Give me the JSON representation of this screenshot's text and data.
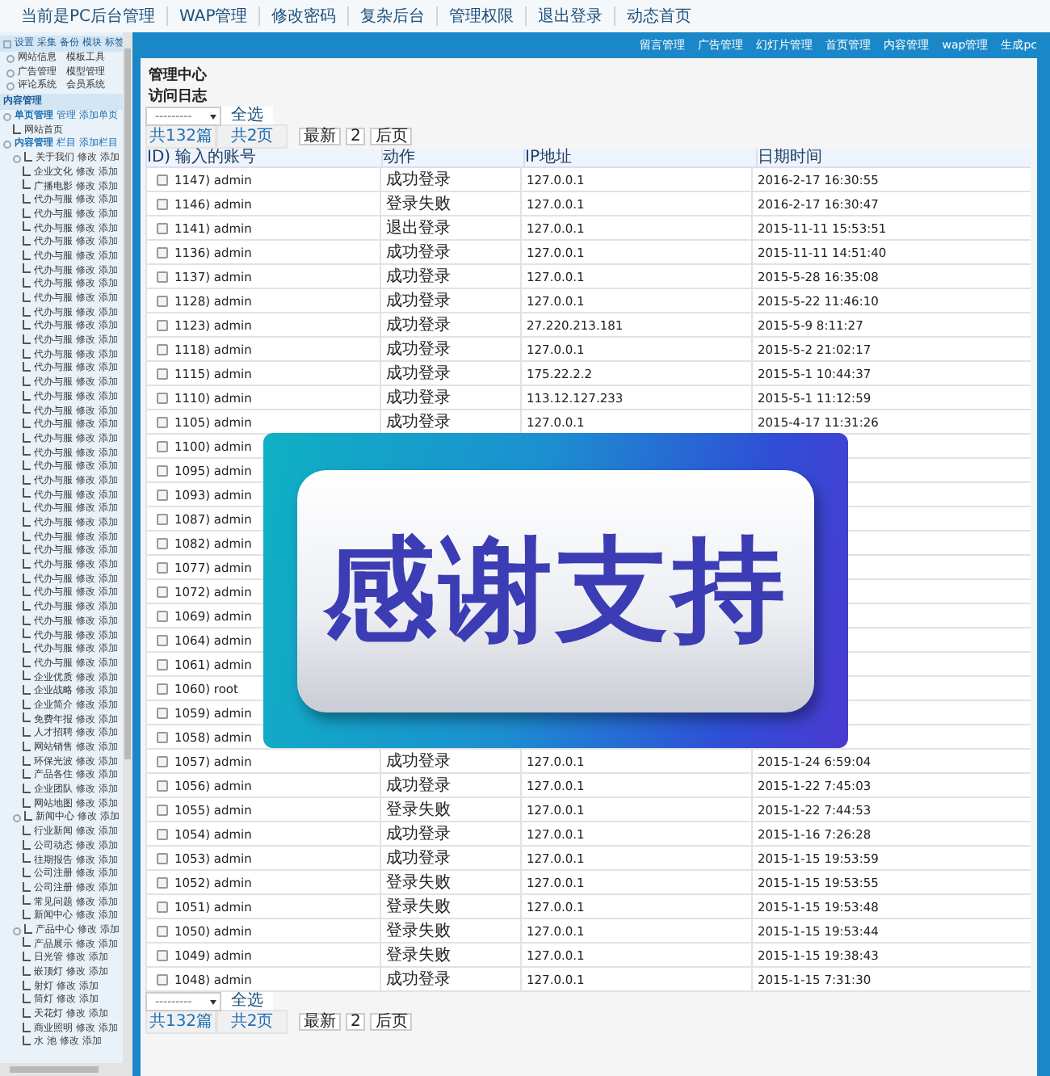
{
  "top_nav": [
    "当前是PC后台管理",
    "WAP管理",
    "修改密码",
    "复杂后台",
    "管理权限",
    "退出登录",
    "动态首页"
  ],
  "sidebar": {
    "top_links": [
      "设置",
      "采集",
      "备份",
      "模块",
      "标签"
    ],
    "tools": [
      [
        "网站信息",
        "模板工具"
      ],
      [
        "广告管理",
        "模型管理"
      ],
      [
        "评论系统",
        "会员系统"
      ]
    ],
    "section_title": "内容管理",
    "groups": [
      {
        "name": "单页管理",
        "actions": [
          "管理",
          "添加单页"
        ],
        "children": [
          {
            "name": "网站首页"
          }
        ]
      },
      {
        "name": "内容管理",
        "actions": [
          "栏目",
          "添加栏目"
        ],
        "children": [
          {
            "name": "关于我们",
            "actions": [
              "修改",
              "添加"
            ],
            "children": [
              {
                "name": "企业文化",
                "actions": [
                  "修改",
                  "添加"
                ]
              },
              {
                "name": "广播电影",
                "actions": [
                  "修改",
                  "添加"
                ]
              },
              {
                "name": "代办与服",
                "actions": [
                  "修改",
                  "添加"
                ]
              },
              {
                "name": "代办与服",
                "actions": [
                  "修改",
                  "添加"
                ]
              },
              {
                "name": "代办与服",
                "actions": [
                  "修改",
                  "添加"
                ]
              },
              {
                "name": "代办与服",
                "actions": [
                  "修改",
                  "添加"
                ]
              },
              {
                "name": "代办与服",
                "actions": [
                  "修改",
                  "添加"
                ]
              },
              {
                "name": "代办与服",
                "actions": [
                  "修改",
                  "添加"
                ]
              },
              {
                "name": "代办与服",
                "actions": [
                  "修改",
                  "添加"
                ]
              },
              {
                "name": "代办与服",
                "actions": [
                  "修改",
                  "添加"
                ]
              },
              {
                "name": "代办与服",
                "actions": [
                  "修改",
                  "添加"
                ]
              },
              {
                "name": "代办与服",
                "actions": [
                  "修改",
                  "添加"
                ]
              },
              {
                "name": "代办与服",
                "actions": [
                  "修改",
                  "添加"
                ]
              },
              {
                "name": "代办与服",
                "actions": [
                  "修改",
                  "添加"
                ]
              },
              {
                "name": "代办与服",
                "actions": [
                  "修改",
                  "添加"
                ]
              },
              {
                "name": "代办与服",
                "actions": [
                  "修改",
                  "添加"
                ]
              },
              {
                "name": "代办与服",
                "actions": [
                  "修改",
                  "添加"
                ]
              },
              {
                "name": "代办与服",
                "actions": [
                  "修改",
                  "添加"
                ]
              },
              {
                "name": "代办与服",
                "actions": [
                  "修改",
                  "添加"
                ]
              },
              {
                "name": "代办与服",
                "actions": [
                  "修改",
                  "添加"
                ]
              },
              {
                "name": "代办与服",
                "actions": [
                  "修改",
                  "添加"
                ]
              },
              {
                "name": "代办与服",
                "actions": [
                  "修改",
                  "添加"
                ]
              },
              {
                "name": "代办与服",
                "actions": [
                  "修改",
                  "添加"
                ]
              },
              {
                "name": "代办与服",
                "actions": [
                  "修改",
                  "添加"
                ]
              },
              {
                "name": "代办与服",
                "actions": [
                  "修改",
                  "添加"
                ]
              },
              {
                "name": "代办与服",
                "actions": [
                  "修改",
                  "添加"
                ]
              },
              {
                "name": "代办与服",
                "actions": [
                  "修改",
                  "添加"
                ]
              },
              {
                "name": "代办与服",
                "actions": [
                  "修改",
                  "添加"
                ]
              },
              {
                "name": "代办与服",
                "actions": [
                  "修改",
                  "添加"
                ]
              },
              {
                "name": "代办与服",
                "actions": [
                  "修改",
                  "添加"
                ]
              },
              {
                "name": "代办与服",
                "actions": [
                  "修改",
                  "添加"
                ]
              },
              {
                "name": "代办与服",
                "actions": [
                  "修改",
                  "添加"
                ]
              },
              {
                "name": "代办与服",
                "actions": [
                  "修改",
                  "添加"
                ]
              },
              {
                "name": "代办与服",
                "actions": [
                  "修改",
                  "添加"
                ]
              },
              {
                "name": "代办与服",
                "actions": [
                  "修改",
                  "添加"
                ]
              },
              {
                "name": "代办与服",
                "actions": [
                  "修改",
                  "添加"
                ]
              },
              {
                "name": "企业优质",
                "actions": [
                  "修改",
                  "添加"
                ]
              },
              {
                "name": "企业战略",
                "actions": [
                  "修改",
                  "添加"
                ]
              },
              {
                "name": "企业简介",
                "actions": [
                  "修改",
                  "添加"
                ]
              },
              {
                "name": "免费年报",
                "actions": [
                  "修改",
                  "添加"
                ]
              },
              {
                "name": "人才招聘",
                "actions": [
                  "修改",
                  "添加"
                ]
              },
              {
                "name": "网站销售",
                "actions": [
                  "修改",
                  "添加"
                ]
              },
              {
                "name": "环保光波",
                "actions": [
                  "修改",
                  "添加"
                ]
              },
              {
                "name": "产品各住",
                "actions": [
                  "修改",
                  "添加"
                ]
              },
              {
                "name": "企业团队",
                "actions": [
                  "修改",
                  "添加"
                ]
              },
              {
                "name": "网站地图",
                "actions": [
                  "修改",
                  "添加"
                ]
              }
            ]
          },
          {
            "name": "新闻中心",
            "actions": [
              "修改",
              "添加"
            ],
            "children": [
              {
                "name": "行业新闻",
                "actions": [
                  "修改",
                  "添加"
                ]
              },
              {
                "name": "公司动态",
                "actions": [
                  "修改",
                  "添加"
                ]
              },
              {
                "name": "往期报告",
                "actions": [
                  "修改",
                  "添加"
                ]
              },
              {
                "name": "公司注册",
                "actions": [
                  "修改",
                  "添加"
                ]
              },
              {
                "name": "公司注册",
                "actions": [
                  "修改",
                  "添加"
                ]
              },
              {
                "name": "常见问题",
                "actions": [
                  "修改",
                  "添加"
                ]
              },
              {
                "name": "新闻中心",
                "actions": [
                  "修改",
                  "添加"
                ]
              }
            ]
          },
          {
            "name": "产品中心",
            "actions": [
              "修改",
              "添加"
            ],
            "children": [
              {
                "name": "产品展示",
                "actions": [
                  "修改",
                  "添加"
                ]
              },
              {
                "name": "日光管",
                "actions": [
                  "修改",
                  "添加"
                ]
              },
              {
                "name": "嵌顶灯",
                "actions": [
                  "修改",
                  "添加"
                ]
              },
              {
                "name": "射灯",
                "actions": [
                  "修改",
                  "添加"
                ]
              },
              {
                "name": "筒灯",
                "actions": [
                  "修改",
                  "添加"
                ]
              },
              {
                "name": "天花灯",
                "actions": [
                  "修改",
                  "添加"
                ]
              },
              {
                "name": "商业照明",
                "actions": [
                  "修改",
                  "添加"
                ]
              },
              {
                "name": "水 池",
                "actions": [
                  "修改",
                  "添加"
                ]
              }
            ]
          }
        ]
      }
    ]
  },
  "header_links": [
    "留言管理",
    "广告管理",
    "幻灯片管理",
    "首页管理",
    "内容管理",
    "wap管理",
    "生成pc"
  ],
  "page_title": "管理中心",
  "section_title": "访问日志",
  "pagers": [
    {
      "select": "---------",
      "select_all": "全选",
      "total_items": "共132篇",
      "total_pages": "共2页",
      "buttons": [
        "最新",
        "2",
        "后页"
      ]
    },
    {
      "select": "---------",
      "select_all": "全选",
      "total_items": "共132篇",
      "total_pages": "共2页",
      "buttons": [
        "最新",
        "2",
        "后页"
      ]
    }
  ],
  "table": {
    "columns": [
      "ID) 输入的账号",
      "动作",
      "IP地址",
      "日期时间"
    ],
    "rows": [
      {
        "account": "1147) admin",
        "action": "成功登录",
        "ip": "127.0.0.1",
        "time": "2016-2-17 16:30:55",
        "checked": false
      },
      {
        "account": "1146) admin",
        "action": "登录失败",
        "ip": "127.0.0.1",
        "time": "2016-2-17 16:30:47",
        "checked": false
      },
      {
        "account": "1141) admin",
        "action": "退出登录",
        "ip": "127.0.0.1",
        "time": "2015-11-11 15:53:51",
        "checked": false
      },
      {
        "account": "1136) admin",
        "action": "成功登录",
        "ip": "127.0.0.1",
        "time": "2015-11-11 14:51:40",
        "checked": false
      },
      {
        "account": "1137) admin",
        "action": "成功登录",
        "ip": "127.0.0.1",
        "time": "2015-5-28 16:35:08",
        "checked": false
      },
      {
        "account": "1128) admin",
        "action": "成功登录",
        "ip": "127.0.0.1",
        "time": "2015-5-22 11:46:10",
        "checked": false
      },
      {
        "account": "1123) admin",
        "action": "成功登录",
        "ip": "27.220.213.181",
        "time": "2015-5-9 8:11:27",
        "checked": false
      },
      {
        "account": "1118) admin",
        "action": "成功登录",
        "ip": "127.0.0.1",
        "time": "2015-5-2 21:02:17",
        "checked": false
      },
      {
        "account": "1115) admin",
        "action": "成功登录",
        "ip": "175.22.2.2",
        "time": "2015-5-1 10:44:37",
        "checked": false
      },
      {
        "account": "1110) admin",
        "action": "成功登录",
        "ip": "113.12.127.233",
        "time": "2015-5-1 11:12:59",
        "checked": false
      },
      {
        "account": "1105) admin",
        "action": "成功登录",
        "ip": "127.0.0.1",
        "time": "2015-4-17 11:31:26",
        "checked": false
      },
      {
        "account": "1100) admin",
        "checked": false
      },
      {
        "account": "1095) admin",
        "checked": false
      },
      {
        "account": "1093) admin",
        "checked": false
      },
      {
        "account": "1087) admin",
        "checked": false
      },
      {
        "account": "1082) admin",
        "checked": false
      },
      {
        "account": "1077) admin",
        "checked": false
      },
      {
        "account": "1072) admin",
        "checked": false
      },
      {
        "account": "1069) admin",
        "checked": false
      },
      {
        "account": "1064) admin",
        "checked": false
      },
      {
        "account": "1061) admin",
        "checked": false
      },
      {
        "account": "1060) root",
        "checked": false
      },
      {
        "account": "1059) admin",
        "checked": false
      },
      {
        "account": "1058) admin",
        "checked": false
      },
      {
        "account": "1057) admin",
        "action": "成功登录",
        "ip": "127.0.0.1",
        "time": "2015-1-24 6:59:04",
        "checked": false
      },
      {
        "account": "1056) admin",
        "action": "成功登录",
        "ip": "127.0.0.1",
        "time": "2015-1-22 7:45:03",
        "checked": false
      },
      {
        "account": "1055) admin",
        "action": "登录失败",
        "ip": "127.0.0.1",
        "time": "2015-1-22 7:44:53",
        "checked": false
      },
      {
        "account": "1054) admin",
        "action": "成功登录",
        "ip": "127.0.0.1",
        "time": "2015-1-16 7:26:28",
        "checked": false
      },
      {
        "account": "1053) admin",
        "action": "成功登录",
        "ip": "127.0.0.1",
        "time": "2015-1-15 19:53:59",
        "checked": false
      },
      {
        "account": "1052) admin",
        "action": "登录失败",
        "ip": "127.0.0.1",
        "time": "2015-1-15 19:53:55",
        "checked": false
      },
      {
        "account": "1051) admin",
        "action": "登录失败",
        "ip": "127.0.0.1",
        "time": "2015-1-15 19:53:48",
        "checked": false
      },
      {
        "account": "1050) admin",
        "action": "登录失败",
        "ip": "127.0.0.1",
        "time": "2015-1-15 19:53:44",
        "checked": false
      },
      {
        "account": "1049) admin",
        "action": "登录失败",
        "ip": "127.0.0.1",
        "time": "2015-1-15 19:38:43",
        "checked": false
      },
      {
        "account": "1048) admin",
        "action": "成功登录",
        "ip": "127.0.0.1",
        "time": "2015-1-15 7:31:30",
        "checked": false
      }
    ]
  },
  "overlay": {
    "text": "感谢支持"
  }
}
